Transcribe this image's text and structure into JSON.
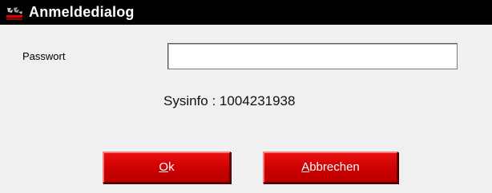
{
  "window": {
    "title": "Anmeldedialog",
    "icon": "app-logo-icon",
    "colors": {
      "titlebar": "#000000",
      "background": "#f0f0f0",
      "button": "#cc0000",
      "button_text": "#ffffff"
    }
  },
  "form": {
    "password_label": "Passwort",
    "password_value": "",
    "password_placeholder": ""
  },
  "sysinfo": {
    "text": "Sysinfo : 1004231938"
  },
  "buttons": {
    "ok": {
      "mnemonic": "O",
      "rest": "k"
    },
    "cancel": {
      "mnemonic": "A",
      "rest": "bbrechen"
    }
  }
}
